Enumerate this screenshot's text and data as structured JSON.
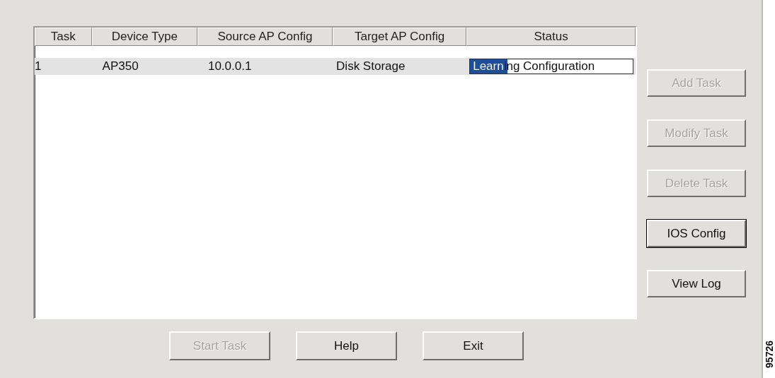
{
  "table": {
    "columns": [
      "Task",
      "Device Type",
      "Source AP Config",
      "Target AP Config",
      "Status"
    ],
    "rows": [
      {
        "selected": true,
        "cells": [
          "1",
          "AP350",
          "10.0.0.1",
          "Disk Storage"
        ],
        "status": {
          "text": "Learning Configuration",
          "level": 0.23
        }
      }
    ]
  },
  "side_buttons": [
    {
      "label": "Add Task",
      "disabled": true,
      "focused": false
    },
    {
      "label": "Modify Task",
      "disabled": true,
      "focused": false
    },
    {
      "label": "Delete Task",
      "disabled": true,
      "focused": false
    },
    {
      "label": "IOS Config",
      "disabled": false,
      "focused": true
    },
    {
      "label": "View Log",
      "disabled": false,
      "focused": false
    }
  ],
  "bottom_buttons": [
    {
      "label": "Start Task",
      "disabled": true
    },
    {
      "label": "Help",
      "disabled": false
    },
    {
      "label": "Exit",
      "disabled": false
    }
  ],
  "figure_number": "95726"
}
